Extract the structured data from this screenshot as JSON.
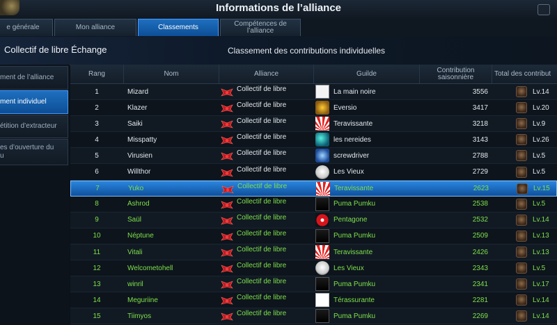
{
  "window": {
    "title": "Informations de l’alliance"
  },
  "tabs": [
    {
      "label": "e générale",
      "active": false
    },
    {
      "label": "Mon alliance",
      "active": false
    },
    {
      "label": "Classements",
      "active": true
    },
    {
      "label": "Compétences de l’alliance",
      "active": false
    }
  ],
  "banner": {
    "alliance_name": "Collectif de libre Échange",
    "section_title": "Classement des contributions individuelles"
  },
  "sidebar": {
    "items": [
      {
        "label": "ment de l’alliance",
        "active": false
      },
      {
        "label": "ment individuel",
        "active": true
      },
      {
        "label": "étition d’extracteur",
        "active": false
      },
      {
        "label": "es d’ouverture du\nu",
        "active": false
      }
    ]
  },
  "table": {
    "headers": {
      "rank": "Rang",
      "name": "Nom",
      "alliance": "Alliance",
      "guild": "Guilde",
      "contribution": "Contribution saisonnière",
      "total": "Total des contribut"
    },
    "rows": [
      {
        "rank": "1",
        "name": "Mizard",
        "alliance": "Collectif de libre",
        "guild": "La main noire",
        "guild_icon": "hand-icon",
        "contribution": "3556",
        "level": "Lv.14"
      },
      {
        "rank": "2",
        "name": "Klazer",
        "alliance": "Collectif de libre",
        "guild": "Eversio",
        "guild_icon": "gold-emblem-icon",
        "contribution": "3417",
        "level": "Lv.20"
      },
      {
        "rank": "3",
        "name": "Saiki",
        "alliance": "Collectif de libre",
        "guild": "Teravissante",
        "guild_icon": "rising-sun-icon",
        "contribution": "3218",
        "level": "Lv.9"
      },
      {
        "rank": "4",
        "name": "Misspatty",
        "alliance": "Collectif de libre",
        "guild": "les nereides",
        "guild_icon": "teal-creature-icon",
        "contribution": "3143",
        "level": "Lv.26"
      },
      {
        "rank": "5",
        "name": "Virusien",
        "alliance": "Collectif de libre",
        "guild": "screwdriver",
        "guild_icon": "blue-wings-icon",
        "contribution": "2788",
        "level": "Lv.5"
      },
      {
        "rank": "6",
        "name": "Willthor",
        "alliance": "Collectif de libre",
        "guild": "Les Vieux",
        "guild_icon": "face-icon",
        "contribution": "2729",
        "level": "Lv.5"
      },
      {
        "rank": "7",
        "name": "Yuko",
        "alliance": "Collectif de libre",
        "guild": "Teravissante",
        "guild_icon": "rising-sun-icon",
        "contribution": "2623",
        "level": "Lv.15",
        "selected": true,
        "green": true
      },
      {
        "rank": "8",
        "name": "Ashrod",
        "alliance": "Collectif de libre",
        "guild": "Puma Pumku",
        "guild_icon": "mask-icon",
        "contribution": "2538",
        "level": "Lv.5",
        "green": true
      },
      {
        "rank": "9",
        "name": "Saül",
        "alliance": "Collectif de libre",
        "guild": "Pentagone",
        "guild_icon": "red-flower-icon",
        "contribution": "2532",
        "level": "Lv.14",
        "green": true
      },
      {
        "rank": "10",
        "name": "Néptune",
        "alliance": "Collectif de libre",
        "guild": "Puma Pumku",
        "guild_icon": "mask-icon",
        "contribution": "2509",
        "level": "Lv.13",
        "green": true
      },
      {
        "rank": "11",
        "name": "Vitali",
        "alliance": "Collectif de libre",
        "guild": "Teravissante",
        "guild_icon": "rising-sun-icon",
        "contribution": "2426",
        "level": "Lv.13",
        "green": true
      },
      {
        "rank": "12",
        "name": "Welcometohell",
        "alliance": "Collectif de libre",
        "guild": "Les Vieux",
        "guild_icon": "face-icon",
        "contribution": "2343",
        "level": "Lv.5",
        "green": true
      },
      {
        "rank": "13",
        "name": "winril",
        "alliance": "Collectif de libre",
        "guild": "Puma Pumku",
        "guild_icon": "mask-icon",
        "contribution": "2341",
        "level": "Lv.17",
        "green": true
      },
      {
        "rank": "14",
        "name": "Meguriine",
        "alliance": "Collectif de libre",
        "guild": "Térassurante",
        "guild_icon": "letter-t-icon",
        "contribution": "2281",
        "level": "Lv.14",
        "green": true
      },
      {
        "rank": "15",
        "name": "Tiimyos",
        "alliance": "Collectif de libre",
        "guild": "Puma Pumku",
        "guild_icon": "mask-icon",
        "contribution": "2269",
        "level": "Lv.14",
        "green": true
      }
    ]
  }
}
